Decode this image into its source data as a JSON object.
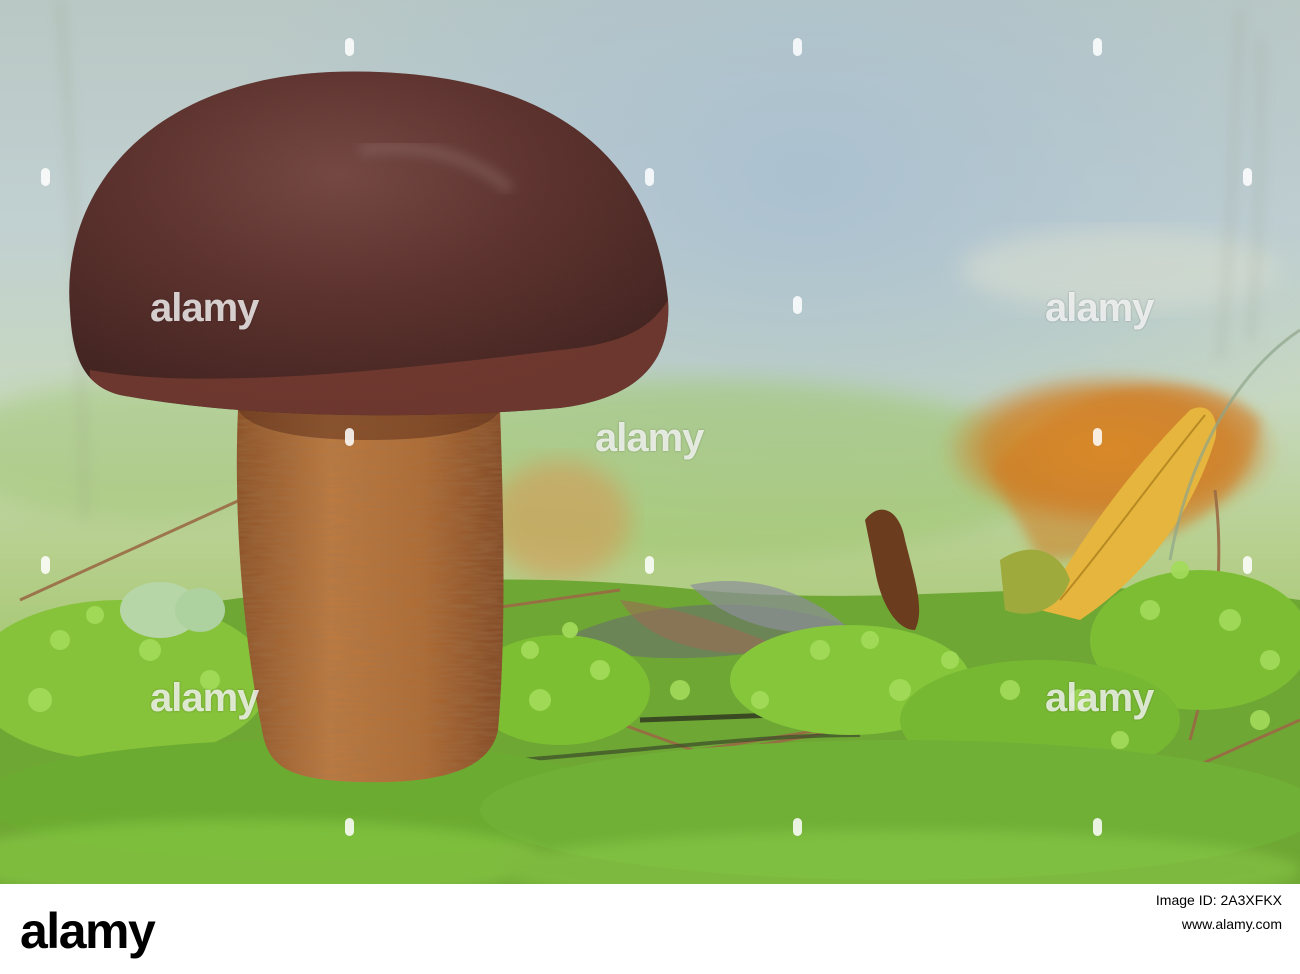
{
  "photo": {
    "subject": "mushroom",
    "colors": {
      "cap": "#5b2f2c",
      "stem": "#b06c35",
      "moss": "#7cc23a",
      "background": "#c9d9cf",
      "leaf": "#e0972d"
    }
  },
  "watermark": {
    "text": "alamy"
  },
  "footer": {
    "logo": "alamy",
    "image_id": "2A3XFKX",
    "site": "www.alamy.com"
  }
}
